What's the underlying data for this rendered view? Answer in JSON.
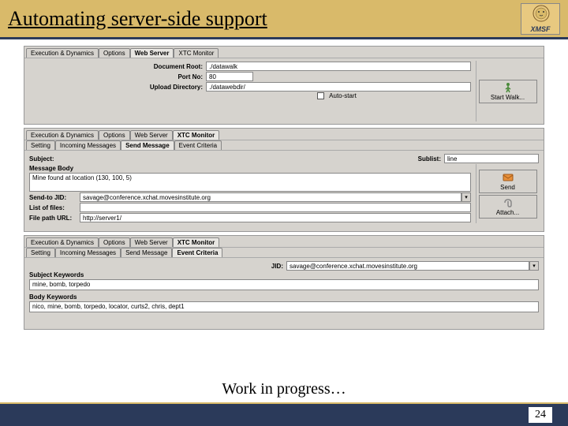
{
  "header": {
    "title": "Automating server-side support",
    "logo_text": "XMSF"
  },
  "panel1": {
    "tabs": [
      "Execution & Dynamics",
      "Options",
      "Web Server",
      "XTC Monitor"
    ],
    "active_tab": "Web Server",
    "doc_root_label": "Document Root:",
    "doc_root_value": "./datawalk",
    "port_label": "Port No:",
    "port_value": "80",
    "upload_label": "Upload Directory:",
    "upload_value": "./datawebdir/",
    "auto_start": "Auto-start",
    "start_btn": "Start Walk..."
  },
  "panel2": {
    "tabs": [
      "Execution & Dynamics",
      "Options",
      "Web Server",
      "XTC Monitor"
    ],
    "active_tab": "XTC Monitor",
    "subtabs": [
      "Setting",
      "Incoming Messages",
      "Send Message",
      "Event Criteria"
    ],
    "active_subtab": "Send Message",
    "subject_label": "Subject:",
    "sublist_label": "Sublist:",
    "sublist_value": "line",
    "body_label": "Message Body",
    "body_value": "Mine found at location (130, 100, 5)",
    "sendto_label": "Send-to JID:",
    "sendto_value": "savage@conference.xchat.movesinstitute.org",
    "files_label": "List of files:",
    "files_value": "",
    "filepath_label": "File path URL:",
    "filepath_value": "http://server1/",
    "send_btn": "Send",
    "attach_btn": "Attach..."
  },
  "panel3": {
    "tabs": [
      "Execution & Dynamics",
      "Options",
      "Web Server",
      "XTC Monitor"
    ],
    "active_tab": "XTC Monitor",
    "subtabs": [
      "Setting",
      "Incoming Messages",
      "Send Message",
      "Event Criteria"
    ],
    "active_subtab": "Event Criteria",
    "jid_label": "JID:",
    "jid_value": "savage@conference.xchat.movesinstitute.org",
    "subj_kw_label": "Subject Keywords",
    "subj_kw_value": "mine, bomb, torpedo",
    "body_kw_label": "Body Keywords",
    "body_kw_value": "nico, mine, bomb, torpedo, locator, curts2, chris, dept1"
  },
  "caption": "Work in progress…",
  "page_number": "24"
}
